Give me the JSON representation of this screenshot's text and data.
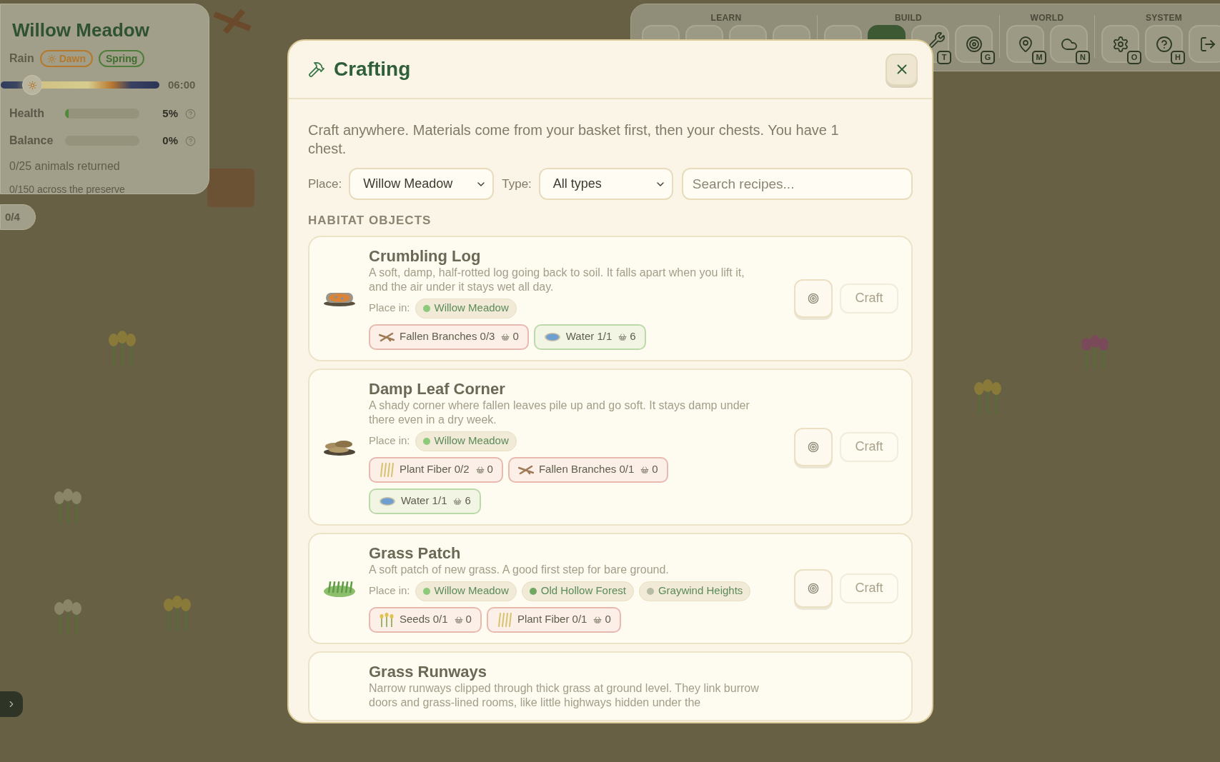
{
  "hud": {
    "title": "Willow Meadow",
    "weather": "Rain",
    "badges": [
      {
        "kind": "time",
        "label": "Dawn"
      },
      {
        "kind": "season",
        "label": "Spring"
      }
    ],
    "clock": {
      "level": 0.2,
      "time": "06:00"
    },
    "stats": [
      {
        "label": "Health",
        "value": "5%",
        "level": 0.05
      },
      {
        "label": "Balance",
        "value": "0%",
        "level": 0
      }
    ],
    "animals": "0/25 animals returned",
    "preserve": "0/150 across the preserve"
  },
  "counter": "0/4",
  "toolbar": {
    "groups": [
      {
        "label": "LEARN",
        "tools": [
          {
            "selected": false
          },
          {
            "selected": false
          },
          {
            "selected": false
          },
          {
            "selected": false
          }
        ]
      },
      {
        "label": "BUILD",
        "tools": [
          {
            "selected": false
          },
          {
            "selected": true
          },
          {
            "selected": false,
            "key": "T"
          },
          {
            "selected": false,
            "key": "G"
          }
        ]
      },
      {
        "label": "WORLD",
        "tools": [
          {
            "selected": false,
            "key": "M"
          },
          {
            "selected": false,
            "key": "N"
          }
        ]
      },
      {
        "label": "SYSTEM",
        "tools": [
          {
            "selected": false,
            "key": "O"
          },
          {
            "selected": false,
            "key": "H"
          },
          {
            "selected": false
          }
        ]
      }
    ]
  },
  "dialog": {
    "title": "Crafting",
    "intro": "Craft anywhere. Materials come from your basket first, then your chests. You have 1 chest.",
    "filters": {
      "place_label": "Place:",
      "place": "Willow Meadow",
      "type_label": "Type:",
      "type": "All types",
      "search_placeholder": "Search recipes..."
    },
    "section": "HABITAT OBJECTS",
    "recipes": [
      {
        "kind": "log",
        "name": "Crumbling Log",
        "description": "A soft, damp, half-rotted log going back to soil. It falls apart when you lift it, and the air under it stays wet all day.",
        "place_label": "Place in:",
        "places": [
          {
            "name": "Willow Meadow",
            "color": "#8cc97a"
          }
        ],
        "ingredients": [
          {
            "kind": "branches",
            "label": "Fallen Branches 0/3",
            "basket": "0",
            "met": false
          },
          {
            "kind": "water",
            "label": "Water 1/1",
            "basket": "6",
            "met": true
          }
        ],
        "craft": "Craft",
        "disabled": true
      },
      {
        "kind": "leaves",
        "name": "Damp Leaf Corner",
        "description": "A shady corner where fallen leaves pile up and go soft. It stays damp under there even in a dry week.",
        "place_label": "Place in:",
        "places": [
          {
            "name": "Willow Meadow",
            "color": "#8cc97a"
          }
        ],
        "ingredients": [
          {
            "kind": "fiber",
            "label": "Plant Fiber 0/2",
            "basket": "0",
            "met": false
          },
          {
            "kind": "branches",
            "label": "Fallen Branches 0/1",
            "basket": "0",
            "met": false
          },
          {
            "kind": "water",
            "label": "Water 1/1",
            "basket": "6",
            "met": true
          }
        ],
        "craft": "Craft",
        "disabled": true
      },
      {
        "kind": "grass",
        "name": "Grass Patch",
        "description": "A soft patch of new grass. A good first step for bare ground.",
        "place_label": "Place in:",
        "places": [
          {
            "name": "Willow Meadow",
            "color": "#8cc97a"
          },
          {
            "name": "Old Hollow Forest",
            "color": "#6fa862"
          },
          {
            "name": "Graywind Heights",
            "color": "#b8bba6"
          }
        ],
        "ingredients": [
          {
            "kind": "seeds",
            "label": "Seeds 0/1",
            "basket": "0",
            "met": false
          },
          {
            "kind": "fiber",
            "label": "Plant Fiber 0/1",
            "basket": "0",
            "met": false
          }
        ],
        "craft": "Craft",
        "disabled": true
      },
      {
        "kind": "runway",
        "name": "Grass Runways",
        "description": "Narrow runways clipped through thick grass at ground level. They link burrow doors and grass-lined rooms, like little highways hidden under the"
      }
    ]
  }
}
